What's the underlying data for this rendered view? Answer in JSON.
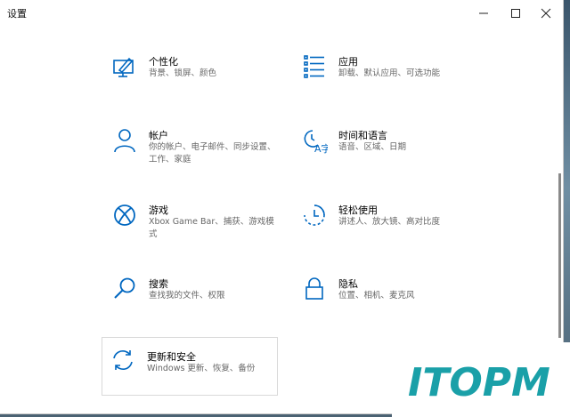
{
  "window": {
    "title": "设置",
    "minimize_icon": "minimize-icon",
    "maximize_icon": "maximize-icon",
    "close_icon": "close-icon"
  },
  "tiles": [
    {
      "id": "personalization",
      "icon": "personalization-icon",
      "name": "个性化",
      "desc": "背景、锁屏、颜色"
    },
    {
      "id": "apps",
      "icon": "apps-icon",
      "name": "应用",
      "desc": "卸载、默认应用、可选功能"
    },
    {
      "id": "accounts",
      "icon": "account-icon",
      "name": "帐户",
      "desc": "你的帐户、电子邮件、同步设置、工作、家庭"
    },
    {
      "id": "time-language",
      "icon": "time-language-icon",
      "name": "时间和语言",
      "desc": "语音、区域、日期"
    },
    {
      "id": "gaming",
      "icon": "xbox-icon",
      "name": "游戏",
      "desc": "Xbox Game Bar、捕获、游戏模式"
    },
    {
      "id": "ease-of-access",
      "icon": "ease-of-access-icon",
      "name": "轻松使用",
      "desc": "讲述人、放大镜、高对比度"
    },
    {
      "id": "search",
      "icon": "search-icon",
      "name": "搜索",
      "desc": "查找我的文件、权限"
    },
    {
      "id": "privacy",
      "icon": "lock-icon",
      "name": "隐私",
      "desc": "位置、相机、麦克风"
    },
    {
      "id": "update-security",
      "icon": "sync-icon",
      "name": "更新和安全",
      "desc": "Windows 更新、恢复、备份"
    }
  ],
  "watermark": {
    "text": "ITOPM",
    "color": "#1aa0a8"
  },
  "colors": {
    "accent": "#0067c0"
  }
}
